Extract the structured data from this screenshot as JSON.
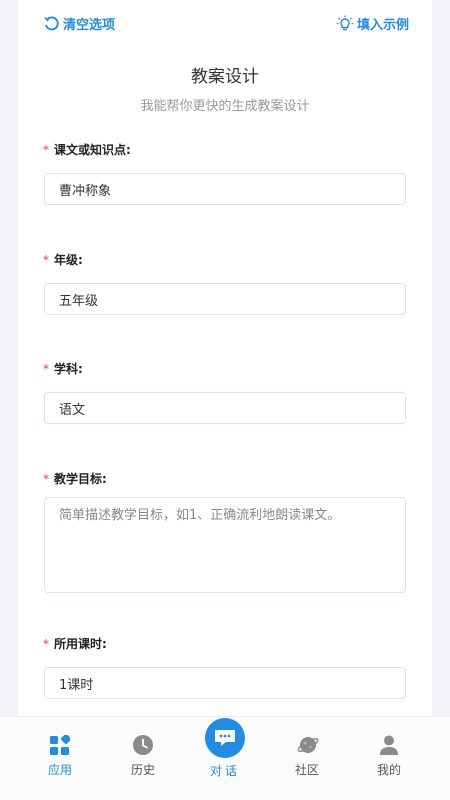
{
  "header": {
    "clear_label": "清空选项",
    "example_label": "填入示例"
  },
  "title": "教案设计",
  "subtitle": "我能帮你更快的生成教案设计",
  "required_mark": "*",
  "fields": {
    "topic": {
      "label": "课文或知识点:",
      "value": "曹冲称象"
    },
    "grade": {
      "label": "年级:",
      "value": "五年级"
    },
    "subject": {
      "label": "学科:",
      "value": "语文"
    },
    "goal": {
      "label": "教学目标:",
      "placeholder": "简单描述教学目标，如1、正确流利地朗读课文。"
    },
    "hours": {
      "label": "所用课时:",
      "value": "1课时"
    }
  },
  "tabbar": {
    "items": [
      {
        "label": "应用",
        "icon": "apps-icon",
        "active": true
      },
      {
        "label": "历史",
        "icon": "clock-icon",
        "active": false
      },
      {
        "label": "对话",
        "icon": "chat-icon",
        "active": false
      },
      {
        "label": "社区",
        "icon": "planet-icon",
        "active": false
      },
      {
        "label": "我的",
        "icon": "user-icon",
        "active": false
      }
    ]
  },
  "colors": {
    "accent": "#1f8ce6",
    "required": "#f0442e",
    "border": "#d4e6f4"
  }
}
